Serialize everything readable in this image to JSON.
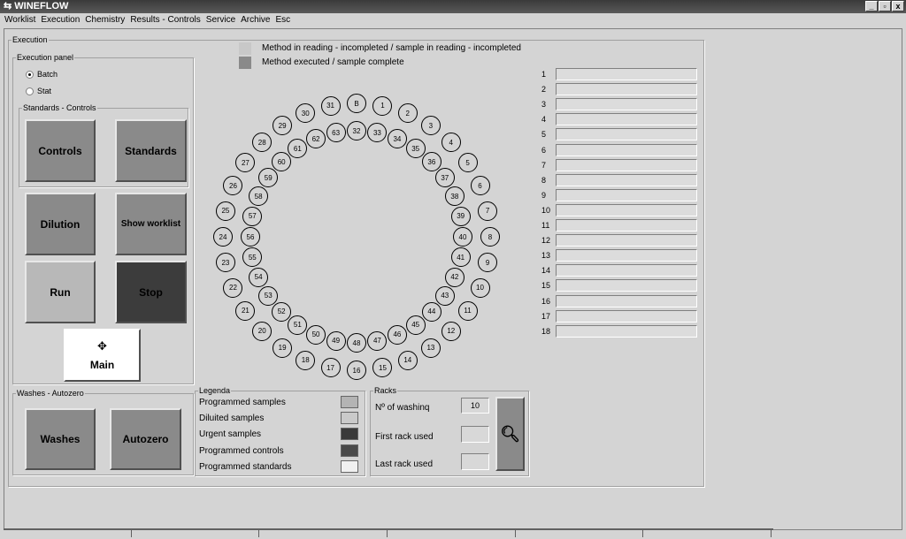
{
  "window": {
    "title": "WINEFLOW",
    "controls": [
      "_",
      "▫",
      "x"
    ]
  },
  "menu": [
    "Worklist",
    "Execution",
    "Chemistry",
    "Results - Controls",
    "Service",
    "Archive",
    "Esc"
  ],
  "execution": {
    "title": "Execution",
    "panel": {
      "title": "Execution panel",
      "radios": [
        {
          "label": "Batch",
          "checked": true
        },
        {
          "label": "Stat",
          "checked": false
        }
      ],
      "standards_title": "Standards - Controls",
      "controls": "Controls",
      "standards": "Standards",
      "dilution": "Dilution",
      "show_worklist": "Show worklist",
      "run": "Run",
      "stop": "Stop",
      "main": "Main"
    },
    "status_legend": [
      {
        "label": "Method in reading - incompleted / sample in reading - incompleted",
        "color": "#c8c8c8"
      },
      {
        "label": "Method executed / sample complete",
        "color": "#8a8a8a"
      }
    ],
    "outer_ring": [
      "B",
      "1",
      "2",
      "3",
      "4",
      "5",
      "6",
      "7",
      "8",
      "9",
      "10",
      "11",
      "12",
      "13",
      "14",
      "15",
      "16",
      "17",
      "18",
      "19",
      "20",
      "21",
      "22",
      "23",
      "24",
      "25",
      "26",
      "27",
      "28",
      "29",
      "30",
      "31"
    ],
    "inner_ring": [
      "32",
      "33",
      "34",
      "35",
      "36",
      "37",
      "38",
      "39",
      "40",
      "41",
      "42",
      "43",
      "44",
      "45",
      "46",
      "47",
      "48",
      "49",
      "50",
      "51",
      "52",
      "53",
      "54",
      "55",
      "56",
      "57",
      "58",
      "59",
      "60",
      "61",
      "62",
      "63"
    ],
    "rack_list": [
      "1",
      "2",
      "3",
      "4",
      "5",
      "6",
      "7",
      "8",
      "9",
      "10",
      "11",
      "12",
      "13",
      "14",
      "15",
      "16",
      "17",
      "18"
    ],
    "washes": {
      "title": "Washes - Autozero",
      "washes": "Washes",
      "autozero": "Autozero"
    },
    "legenda": {
      "title": "Legenda",
      "items": [
        {
          "label": "Programmed samples",
          "color": "#b4b4b4"
        },
        {
          "label": "Diluited samples",
          "color": "#cacaca"
        },
        {
          "label": "Urgent samples",
          "color": "#3a3a3a"
        },
        {
          "label": "Programmed controls",
          "color": "#4a4a4a"
        },
        {
          "label": "Programmed standards",
          "color": "#f0f0f0"
        }
      ]
    },
    "racks": {
      "title": "Racks",
      "washing_label": "Nº of washinq",
      "washing_value": "10",
      "first_label": "First rack used",
      "first_value": "",
      "last_label": "Last rack used",
      "last_value": ""
    }
  }
}
